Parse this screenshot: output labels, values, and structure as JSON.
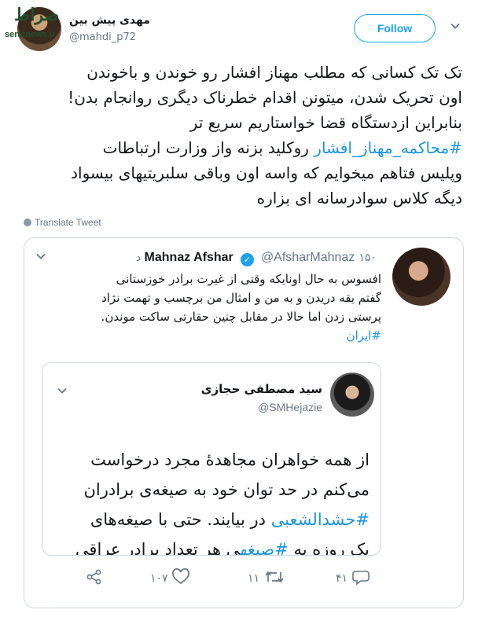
{
  "tweet": {
    "author_name": "مهدی پیش بین",
    "author_handle": "@mahdi_p72",
    "follow_label": "Follow",
    "lines": [
      "تک تک کسانی که مطلب مهناز افشار رو خوندن و باخوندن",
      "اون تحریک شدن، میتونن اقدام خطرناک دیگری روانجام بدن!",
      "بنابراین ازدستگاه قضا خواستاریم سریع تر"
    ],
    "line4_hashtag": "#محاکمه_مهناز_افشار",
    "line4_rest": " روکلید بزنه واز وزارت ارتباطات",
    "line5": "وپلیس فتاهم میخوایم که واسه اون وباقی سلبریتیهای بیسواد",
    "line6": "دیگه کلاس سوادرسانه ای بزاره",
    "translate_label": "Translate Tweet"
  },
  "watermark": {
    "logo": "صراط",
    "site": "seratnews.ir"
  },
  "quoted": {
    "name": "Mahnaz Afshar",
    "handle": "@AfsharMahnaz",
    "time": "۱۵۰ د",
    "lines": [
      "افسوس به حال اونایکه وقتی از غیرت برادر خوزستانی",
      "گفتم یقه دریدن و به من و امثال من برچسب و تهمت نژاد",
      "پرستی زدن اما حالا در مقابل چنین حقارتی ساکت موندن."
    ],
    "hashtag": "#ایران",
    "inner": {
      "name": "سید مصطفی حجازی",
      "handle": "@SMHejazie",
      "line1": "از همه خواهران مجاهدهٔ مجرد درخواست",
      "line2": "می‌کنم در حد توان خود به صیغه‌ی برادران",
      "line3_hashtag": "#حشدالشعبی",
      "line3_rest": " در بیایند. حتی با صیغه‌های",
      "line4_a": "یک روزه به ",
      "line4_hashtag": "#صیغه",
      "line4_b": "ی هر تعداد برادر عراقی"
    }
  },
  "actions": {
    "reply_count": "",
    "retweet_count": "۱۱",
    "like_count": "۱۰۷",
    "comment_count": "۴۱"
  },
  "colors": {
    "accent": "#1da1f2",
    "hashtag": "#1b95e0",
    "muted": "#657786",
    "border": "#ccd6dd"
  }
}
